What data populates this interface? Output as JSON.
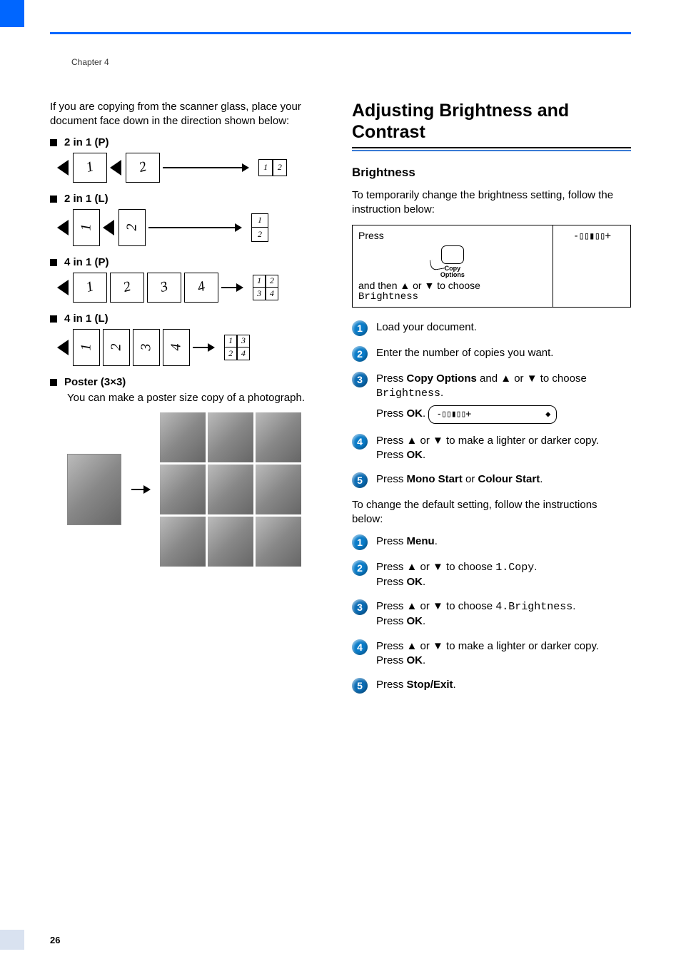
{
  "chapter": "Chapter 4",
  "page_number": "26",
  "left": {
    "intro": "If you are copying from the scanner glass, place your document face down in the direction shown below:",
    "layouts": {
      "p2in1": "2 in 1 (P)",
      "l2in1": "2 in 1 (L)",
      "p4in1": "4 in 1 (P)",
      "l4in1": "4 in 1 (L)",
      "poster": "Poster (3×3)"
    },
    "poster_desc": "You can make a poster size copy of a photograph."
  },
  "right": {
    "heading": "Adjusting Brightness and Contrast",
    "sub_heading": "Brightness",
    "sub_intro": "To temporarily change the brightness setting, follow the instruction below:",
    "table": {
      "press": "Press",
      "copy": "Copy",
      "options": "Options",
      "and_then": "and then ▲ or ▼ to choose",
      "brightness": "Brightness",
      "bars": "-▯▯▮▯▯+"
    },
    "steps_a": {
      "s1": "Load your document.",
      "s2": "Enter the number of copies you want.",
      "s3_a": "Press ",
      "s3_copy_options": "Copy Options",
      "s3_b": " and ▲ or ▼ to choose ",
      "s3_brightness": "Brightness",
      "s3_c": ".",
      "s3_ok": "Press ",
      "ok": "OK",
      "lcd": "-▯▯▮▯▯+",
      "s4_a": "Press ▲ or ▼ to make a lighter or darker copy.",
      "s4_ok": "Press ",
      "s5_a": "Press ",
      "mono": "Mono Start",
      "or": " or ",
      "colour": "Colour Start",
      "dot": "."
    },
    "default_intro": "To change the default setting, follow the instructions below:",
    "steps_b": {
      "s1_a": "Press ",
      "menu": "Menu",
      "dot": ".",
      "s2_a": "Press ▲ or ▼ to choose ",
      "copy_code": "1.Copy",
      "ok_line": "Press ",
      "ok": "OK",
      "s3_a": "Press ▲ or ▼ to choose ",
      "bright_code": "4.Brightness",
      "s4_a": "Press ▲ or ▼ to make a lighter or darker copy.",
      "s5_a": "Press ",
      "stop_exit": "Stop/Exit"
    }
  }
}
